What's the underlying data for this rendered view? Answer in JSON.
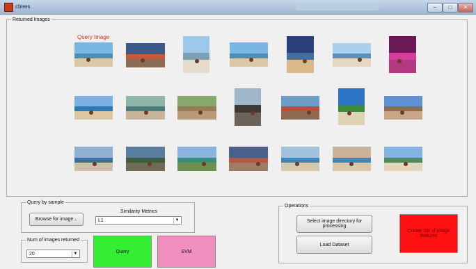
{
  "window": {
    "title": "cbires",
    "controls": [
      "minimize-icon",
      "maximize-icon",
      "close-icon"
    ]
  },
  "returned_panel": {
    "title": "Returned Images",
    "query_label": "Query Image",
    "images": [
      {
        "sky": "#7bb6e0",
        "sea": "#4a8fb8",
        "sand": "#d9c9a4"
      },
      {
        "sky": "#3b5a8a",
        "sea": "#c45a3a",
        "sand": "#8c6b55"
      },
      {
        "sky": "#9cc8ea",
        "sea": "#7ea0b6",
        "sand": "#e6dccb"
      },
      {
        "sky": "#7bb6e0",
        "sea": "#4a8fb8",
        "sand": "#d9c9a4"
      },
      {
        "sky": "#2b3f7a",
        "sea": "#456f9c",
        "sand": "#d8b98a"
      },
      {
        "sky": "#a9d0ee",
        "sea": "#5d8fb8",
        "sand": "#e4d8c2"
      },
      {
        "sky": "#6a1a55",
        "sea": "#d43f9c",
        "sand": "#b2397f"
      },
      {
        "sky": "#7ab3e3",
        "sea": "#2f79b5",
        "sand": "#dcc7a0"
      },
      {
        "sky": "#8fb7a8",
        "sea": "#4c7d7c",
        "sand": "#c7b49a"
      },
      {
        "sky": "#87a86a",
        "sea": "#9b7a56",
        "sand": "#b89b76"
      },
      {
        "sky": "#9fb7c9",
        "sea": "#3f3a34",
        "sand": "#6d625a"
      },
      {
        "sky": "#6e9cc9",
        "sea": "#b94f3f",
        "sand": "#8f6a52"
      },
      {
        "sky": "#2e74c7",
        "sea": "#3d8a3b",
        "sand": "#e0d2b4"
      },
      {
        "sky": "#5f92d4",
        "sea": "#8a6d52",
        "sand": "#c9a889"
      },
      {
        "sky": "#8fb0d3",
        "sea": "#3d6f9c",
        "sand": "#cdbfa8"
      },
      {
        "sky": "#577d9f",
        "sea": "#3d5f3b",
        "sand": "#6f6b55"
      },
      {
        "sky": "#88b4dd",
        "sea": "#3c8c7a",
        "sand": "#6f8f4f"
      },
      {
        "sky": "#4a5f8a",
        "sea": "#b6573f",
        "sand": "#9c7e65"
      },
      {
        "sky": "#a2c2de",
        "sea": "#3d86b7",
        "sand": "#d8c8ab"
      },
      {
        "sky": "#c9b39a",
        "sea": "#3f87b9",
        "sand": "#d7c7ab"
      },
      {
        "sky": "#83b3e2",
        "sea": "#4f8a5c",
        "sand": "#e2d5bb"
      }
    ]
  },
  "query_by_sample": {
    "title": "Query by sample",
    "browse_button": "Browse for image...",
    "metrics_label": "Similarity Metrics",
    "metrics_value": "L1"
  },
  "num_returned": {
    "title": "Num of images returned",
    "value": "20"
  },
  "buttons": {
    "query": "Query",
    "svm": "SVM"
  },
  "operations": {
    "title": "Operations",
    "select_dir": "Select image directory for processing",
    "load_dataset": "Load Dataset",
    "create_db": "Create DB of image features"
  },
  "colors": {
    "query_bg": "#33ee33",
    "svm_bg": "#f08ec0",
    "create_db_bg": "#ff1111",
    "query_label": "#e02b1f"
  }
}
